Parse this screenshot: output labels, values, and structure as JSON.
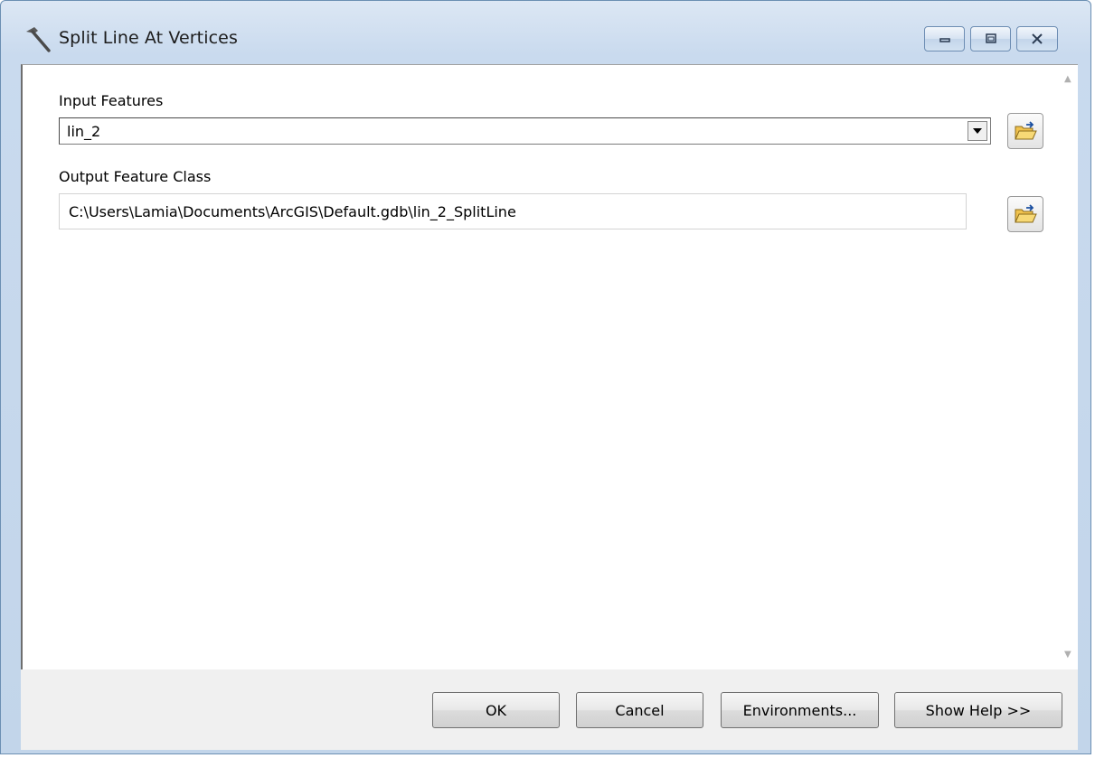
{
  "window": {
    "title": "Split Line At Vertices",
    "controls": {
      "minimize_icon": "minimize-icon",
      "maximize_icon": "maximize-icon",
      "close_icon": "close-icon"
    }
  },
  "form": {
    "input_features": {
      "label": "Input Features",
      "value": "lin_2",
      "dropdown_icon": "chevron-down-icon",
      "browse_icon": "open-folder-icon"
    },
    "output_feature_class": {
      "label": "Output Feature Class",
      "value": "C:\\Users\\Lamia\\Documents\\ArcGIS\\Default.gdb\\lin_2_SplitLine",
      "browse_icon": "open-folder-icon"
    }
  },
  "footer": {
    "ok_label": "OK",
    "cancel_label": "Cancel",
    "environments_label": "Environments...",
    "show_help_label": "Show Help >>"
  },
  "colors": {
    "titlebar": "#c9daee",
    "client": "#f0f0f0",
    "panel": "#ffffff",
    "folder": "#e8b93c"
  }
}
